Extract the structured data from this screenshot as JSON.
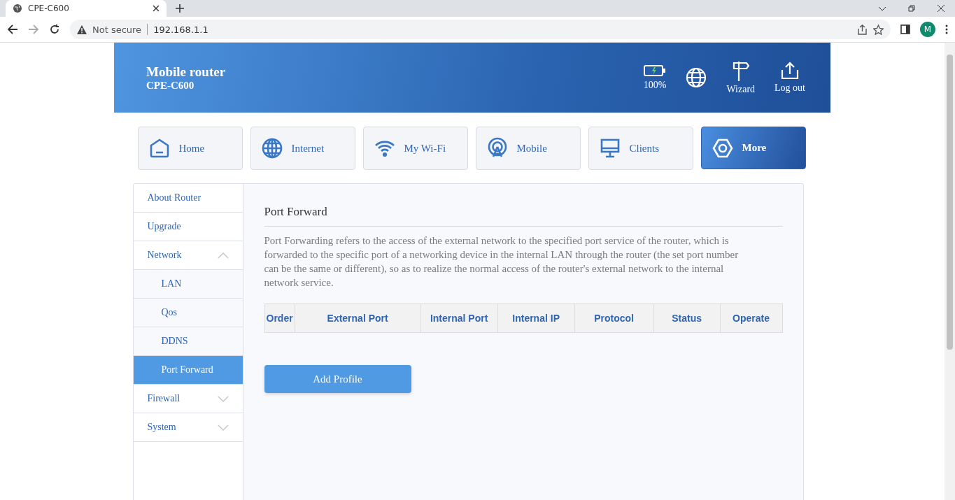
{
  "browser": {
    "tab_title": "CPE-C600",
    "security": "Not secure",
    "address": "192.168.1.1",
    "profile_initial": "M"
  },
  "header": {
    "title": "Mobile router",
    "model": "CPE-C600",
    "battery": "100%",
    "actions": [
      {
        "kind": "language"
      },
      {
        "kind": "wizard",
        "label": "Wizard"
      },
      {
        "kind": "logout",
        "label": "Log out"
      }
    ]
  },
  "tabs": [
    {
      "kind": "home",
      "label": "Home",
      "selected": false
    },
    {
      "kind": "internet",
      "label": "Internet",
      "selected": false
    },
    {
      "kind": "wifi",
      "label": "My Wi-Fi",
      "selected": false
    },
    {
      "kind": "mobile",
      "label": "Mobile",
      "selected": false
    },
    {
      "kind": "clients",
      "label": "Clients",
      "selected": false
    },
    {
      "kind": "more",
      "label": "More",
      "selected": true
    }
  ],
  "sidebar": {
    "items": [
      {
        "label": "About Router",
        "selected": false
      },
      {
        "label": "Upgrade",
        "selected": false
      },
      {
        "label": "Network",
        "selected": false,
        "expanded": true,
        "children": [
          {
            "label": "LAN",
            "selected": false
          },
          {
            "label": "Qos",
            "selected": false
          },
          {
            "label": "DDNS",
            "selected": false
          },
          {
            "label": "Port Forward",
            "selected": true
          }
        ]
      },
      {
        "label": "Firewall",
        "selected": false,
        "expanded": false
      },
      {
        "label": "System",
        "selected": false,
        "expanded": false
      }
    ]
  },
  "panel": {
    "title": "Port Forward",
    "description": "Port Forwarding refers to the access of the external network to the specified port service of the router, which is forwarded to the specific port of a networking device in the internal LAN through the router (the set port number can be the same or different), so as to realize the normal access of the router's external network to the internal network service.",
    "table": {
      "columns": [
        "Order",
        "External Port",
        "Internal Port",
        "Internal IP",
        "Protocol",
        "Status",
        "Operate"
      ]
    },
    "add_button": "Add Profile"
  }
}
